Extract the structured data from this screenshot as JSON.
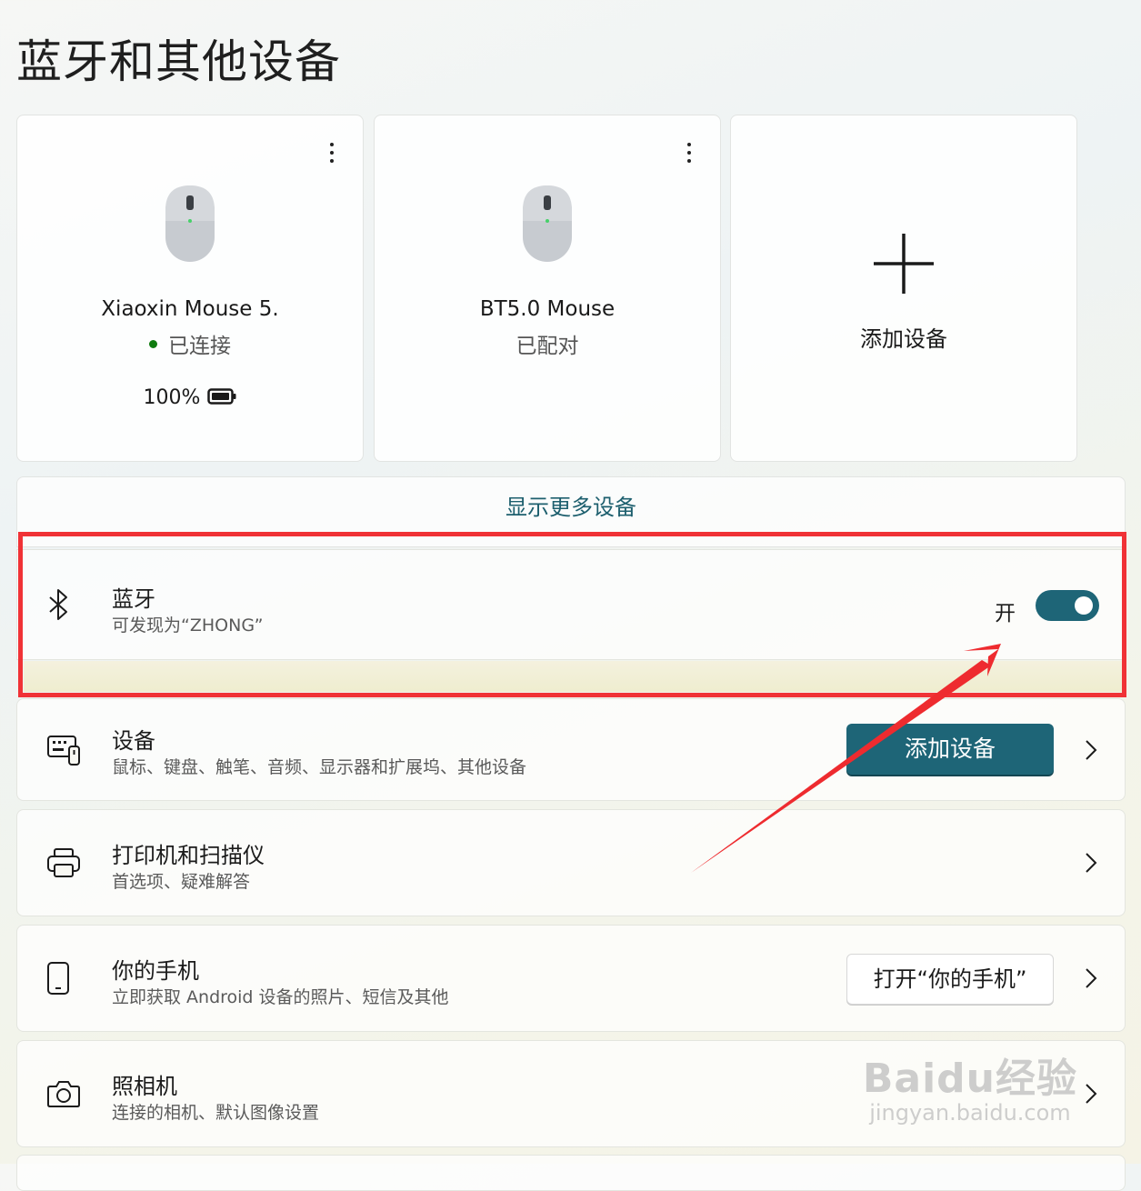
{
  "page": {
    "title": "蓝牙和其他设备"
  },
  "cards": [
    {
      "name": "Xiaoxin Mouse 5.",
      "status": "已连接",
      "battery": "100%"
    },
    {
      "name": "BT5.0 Mouse",
      "status": "已配对"
    }
  ],
  "add_card": {
    "label": "添加设备"
  },
  "show_more": "显示更多设备",
  "bluetooth": {
    "title": "蓝牙",
    "subtitle": "可发现为“ZHONG”",
    "toggle_label": "开",
    "toggle_on": true
  },
  "devices": {
    "title": "设备",
    "subtitle": "鼠标、键盘、触笔、音频、显示器和扩展坞、其他设备",
    "button": "添加设备"
  },
  "printers": {
    "title": "打印机和扫描仪",
    "subtitle": "首选项、疑难解答"
  },
  "phone": {
    "title": "你的手机",
    "subtitle": "立即获取 Android 设备的照片、短信及其他",
    "button": "打开“你的手机”"
  },
  "camera": {
    "title": "照相机",
    "subtitle": "连接的相机、默认图像设置"
  },
  "watermark": {
    "brand": "Baidu经验",
    "url": "jingyan.baidu.com"
  },
  "colors": {
    "accent": "#1e6577",
    "highlight": "#f03236",
    "connected_dot": "#0f7b0f"
  }
}
